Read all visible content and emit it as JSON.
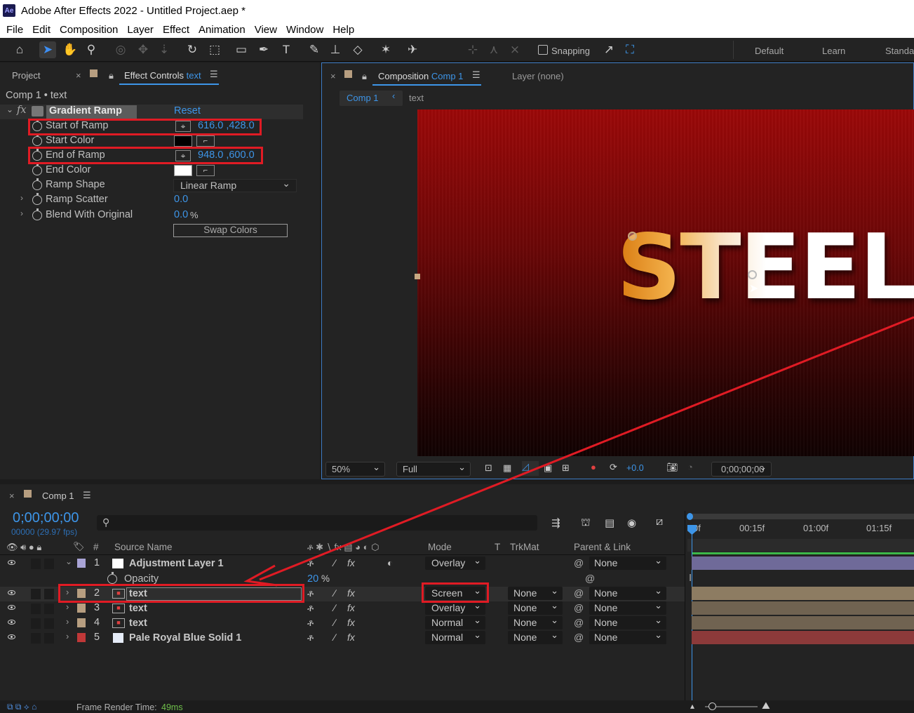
{
  "app": {
    "title": "Adobe After Effects 2022 - Untitled Project.aep *",
    "logo": "Ae"
  },
  "menu": [
    "File",
    "Edit",
    "Composition",
    "Layer",
    "Effect",
    "Animation",
    "View",
    "Window",
    "Help"
  ],
  "toolbar": {
    "snapping_label": "Snapping",
    "workspaces": [
      "Default",
      "Learn",
      "Standa"
    ]
  },
  "effect_controls": {
    "tab_project": "Project",
    "tab_label": "Effect Controls",
    "tab_layer": "text",
    "breadcrumb": "Comp 1 • text",
    "effect_name": "Gradient Ramp",
    "reset": "Reset",
    "fx": "fx",
    "params": {
      "start_of_ramp": {
        "label": "Start of Ramp",
        "value": "616.0 ,428.0"
      },
      "start_color": {
        "label": "Start Color",
        "color": "#000000"
      },
      "end_of_ramp": {
        "label": "End of Ramp",
        "value": "948.0 ,600.0"
      },
      "end_color": {
        "label": "End Color",
        "color": "#ffffff"
      },
      "ramp_shape": {
        "label": "Ramp Shape",
        "value": "Linear Ramp"
      },
      "ramp_scatter": {
        "label": "Ramp Scatter",
        "value": "0.0"
      },
      "blend": {
        "label": "Blend With Original",
        "value": "0.0",
        "unit": "%"
      },
      "swap": "Swap Colors"
    }
  },
  "composition": {
    "tab_label": "Composition",
    "tab_comp": "Comp 1",
    "layer_tab": "Layer (none)",
    "sub_tab_comp": "Comp 1",
    "sub_tab_text": "text",
    "canvas_text": "STEEL",
    "zoom": "50%",
    "resolution": "Full",
    "exposure": "+0.0",
    "timecode": "0;00;00;00"
  },
  "timeline": {
    "tab": "Comp 1",
    "timecode": "0;00;00;00",
    "frames": "00000 (29.97 fps)",
    "columns": {
      "hash": "#",
      "source_name": "Source Name",
      "mode": "Mode",
      "t": "T",
      "trkmat": "TrkMat",
      "parent": "Parent & Link"
    },
    "ruler": [
      "0f",
      "00:15f",
      "01:00f",
      "01:15f"
    ],
    "opacity_label": "Opacity",
    "opacity_value": "20",
    "opacity_unit": "%",
    "layers": [
      {
        "num": "1",
        "name": "Adjustment Layer 1",
        "mode": "Overlay",
        "trkmat": "",
        "parent": "None",
        "swatch": "#a9a4d6",
        "track": "#6f6a99"
      },
      {
        "num": "2",
        "name": "text",
        "mode": "Screen",
        "trkmat": "None",
        "parent": "None",
        "swatch": "#b79e80",
        "track": "#8d7c62"
      },
      {
        "num": "3",
        "name": "text",
        "mode": "Overlay",
        "trkmat": "None",
        "parent": "None",
        "swatch": "#b79e80",
        "track": "#706351"
      },
      {
        "num": "4",
        "name": "text",
        "mode": "Normal",
        "trkmat": "None",
        "parent": "None",
        "swatch": "#b79e80",
        "track": "#706351"
      },
      {
        "num": "5",
        "name": "Pale Royal Blue Solid 1",
        "mode": "Normal",
        "trkmat": "None",
        "parent": "None",
        "swatch": "#c03838",
        "track": "#8c3a3a"
      }
    ]
  },
  "status": {
    "label": "Frame Render Time:",
    "value": "49ms"
  },
  "colors": {
    "accent": "#3d95e8",
    "highlight": "#e01b24"
  }
}
